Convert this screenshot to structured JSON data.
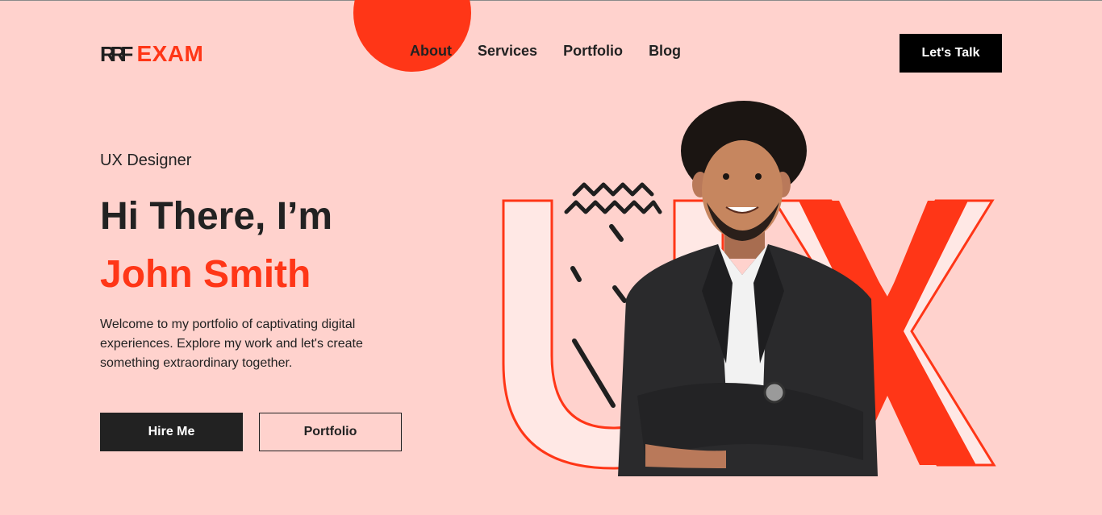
{
  "header": {
    "logo_mark": "RRF",
    "logo_text": "EXAM",
    "nav": [
      "About",
      "Services",
      "Portfolio",
      "Blog"
    ],
    "cta": "Let's Talk"
  },
  "hero": {
    "role": "UX Designer",
    "greeting": "Hi There, I’m",
    "name": "John Smith",
    "intro": "Welcome to my portfolio of captivating digital experiences. Explore my work and let's create something extraordinary together.",
    "primary_button": "Hire Me",
    "secondary_button": "Portfolio"
  },
  "colors": {
    "background": "#FFD2CD",
    "accent": "#FF3617",
    "dark": "#222222"
  },
  "icons": [
    "wave-squiggle-icon",
    "zigzag-icon",
    "chevron-down-icon"
  ]
}
